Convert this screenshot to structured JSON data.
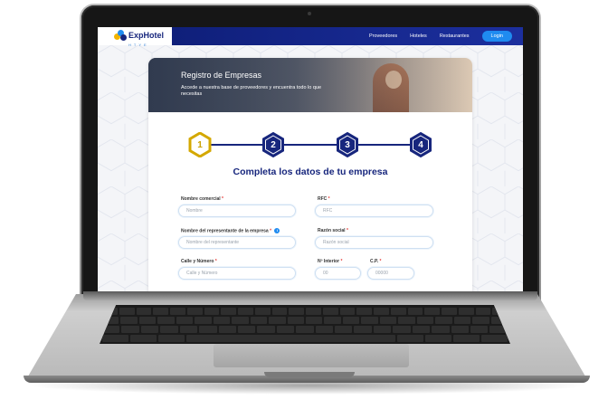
{
  "header": {
    "logo_text": "ExpHotel",
    "logo_sub": "HTYE",
    "nav": [
      "Proveedores",
      "Hoteles",
      "Restaurantes"
    ],
    "login_label": "Login"
  },
  "hero": {
    "title": "Registro de Empresas",
    "subtitle": "Accede a nuestra base de proveedores y encuentra todo lo que necesitas"
  },
  "stepper": {
    "steps": [
      "1",
      "2",
      "3",
      "4"
    ],
    "active_step": 1,
    "active_color": "#d4a800",
    "inactive_color": "#17267d"
  },
  "form": {
    "title": "Completa los datos de tu empresa",
    "fields": {
      "nombre_comercial": {
        "label": "Nombre comercial",
        "required": "*",
        "placeholder": "Nombre"
      },
      "rfc": {
        "label": "RFC",
        "required": "*",
        "placeholder": "RFC"
      },
      "representante": {
        "label": "Nombre del representante de la empresa",
        "required": "*",
        "placeholder": "Nombre del representante"
      },
      "razon_social": {
        "label": "Razón social",
        "required": "*",
        "placeholder": "Razón social"
      },
      "calle": {
        "label": "Calle y Número",
        "required": "*",
        "placeholder": "Calle y Número"
      },
      "interior": {
        "label": "Nº Interior",
        "required": "*",
        "placeholder": "00"
      },
      "cp": {
        "label": "C.P.",
        "required": "*",
        "placeholder": "00000"
      }
    },
    "info_glyph": "i"
  },
  "colors": {
    "brand_navy": "#17267d",
    "accent_blue": "#1f8bf0",
    "required_red": "#e53935"
  }
}
